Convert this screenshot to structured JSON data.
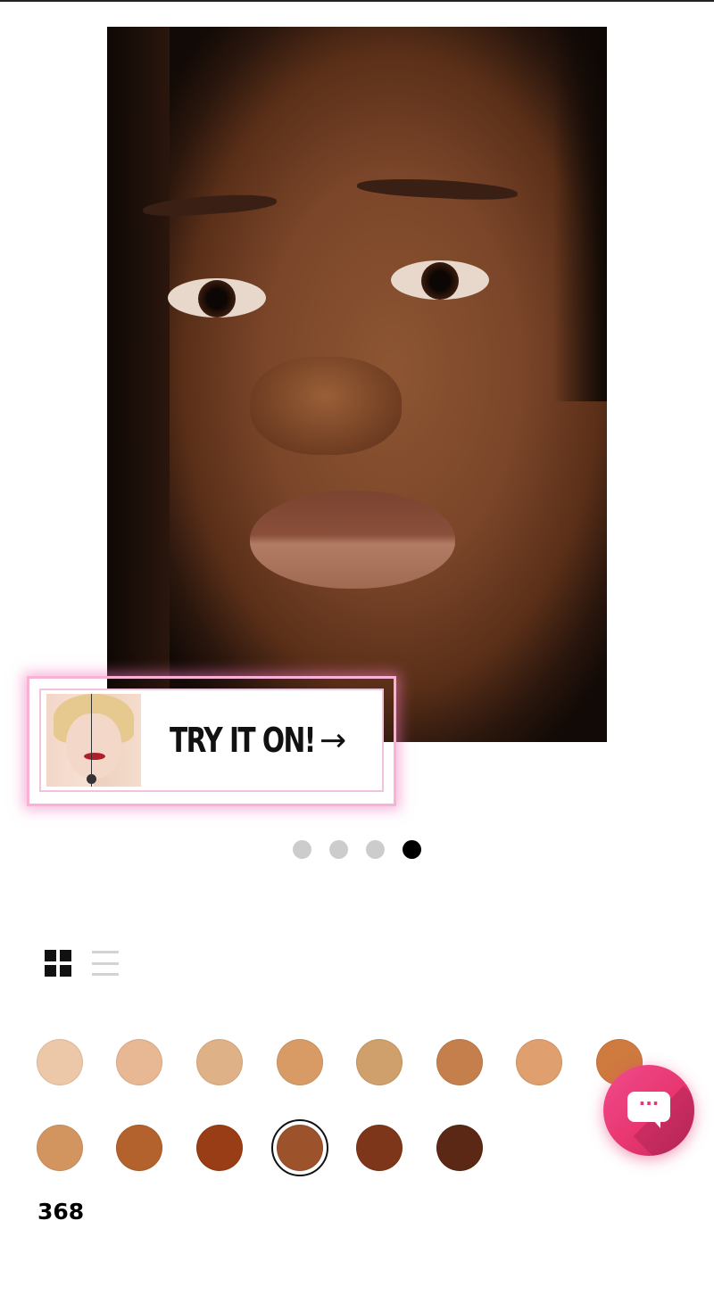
{
  "gallery": {
    "try_on_label": "TRY IT ON!",
    "arrow_glyph": "→",
    "pager": {
      "total": 4,
      "active_index": 3
    }
  },
  "view_toggle": {
    "active": "grid"
  },
  "swatches": {
    "row1": [
      "#ecc8a8",
      "#e8b793",
      "#dfb186",
      "#d99b66",
      "#cfa06c",
      "#c47f4c",
      "#df9f6e",
      "#cf7a3e"
    ],
    "row2": [
      "#d39560",
      "#b3612d",
      "#983d15",
      "#9c522a",
      "#7d3619",
      "#5a2814"
    ],
    "selected_row": 2,
    "selected_index": 3
  },
  "selected_shade": "368",
  "chat": {
    "glyph": "···",
    "icon": "chat-bubble-icon"
  }
}
